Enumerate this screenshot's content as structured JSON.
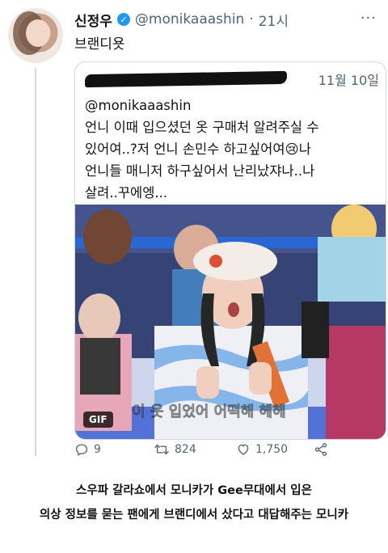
{
  "author": {
    "name": "신정우",
    "handle": "@monikaaashin",
    "time": "21시",
    "verified": true
  },
  "tweet": {
    "text": "브랜디욧"
  },
  "quoted": {
    "date": "11월 10일",
    "mention": "@monikaaashin",
    "lines": [
      "언니 이때 입으셨던 옷 구매처 알려주실 수",
      "있어여..?저 언니 손민수 하고싶어여😢나",
      "언니들 매니저 하구싶어서 난리났쟈나..나",
      "살려..꾸에엥..."
    ],
    "media": {
      "badge": "GIF",
      "subtitle": "이 옷 입었어 어떡해 헤헤"
    }
  },
  "actions": {
    "replies": "9",
    "retweets": "824",
    "likes": "1,750"
  },
  "caption": {
    "line1": "스우파 갈라쇼에서 모니카가 Gee무대에서 입은",
    "line2": "의상 정보를 묻는 팬에게 브랜디에서 샀다고 대답해주는 모니카"
  },
  "colors": {
    "link": "#1d9bf0",
    "muted": "#536471",
    "border": "#cfd9de"
  }
}
